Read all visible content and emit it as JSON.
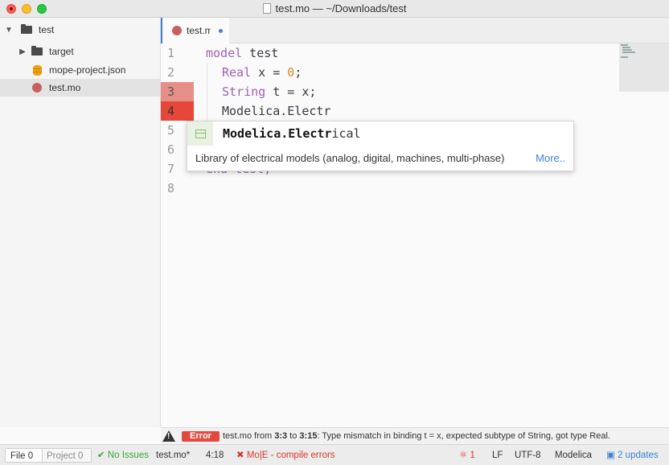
{
  "window": {
    "title": "test.mo — ~/Downloads/test"
  },
  "sidebar": {
    "root": "test",
    "items": [
      {
        "label": "target"
      },
      {
        "label": "mope-project.json"
      },
      {
        "label": "test.mo"
      }
    ]
  },
  "tab": {
    "label": "test.mo"
  },
  "editor": {
    "line_numbers": [
      "1",
      "2",
      "3",
      "4",
      "5",
      "6",
      "7",
      "8"
    ],
    "lines": [
      {
        "kw": "model",
        "rest": " test"
      },
      {
        "kw": "Real",
        "pre": " x = ",
        "num": "0",
        "post": ";"
      },
      {
        "kw": "String",
        "rest": " t = x;"
      },
      {
        "plain": "Modelica.Electr"
      },
      {
        "hidden_fragment": "end test;"
      }
    ]
  },
  "autocomplete": {
    "typed": "Modelica.Electr",
    "rest": "ical",
    "description": "Library of electrical models (analog, digital, machines, multi-phase)",
    "more": "More.."
  },
  "error_panel": {
    "badge": "Error",
    "file": "test.mo",
    "from_word": "from",
    "from": "3:3",
    "to_word": "to",
    "to": "3:15",
    "message": ": Type mismatch in binding t = x, expected subtype of String, got type Real."
  },
  "status": {
    "file_label": "File",
    "file_count": "0",
    "project_label": "Project",
    "project_count": "0",
    "no_issues": "No Issues",
    "filename": "test.mo*",
    "cursor": "4:18",
    "compile_errors": "Mo|E - compile errors",
    "bug_count": "1",
    "line_ending": "LF",
    "encoding": "UTF-8",
    "grammar": "Modelica",
    "updates": "2 updates"
  },
  "colors": {
    "accent": "#3a83d6",
    "error": "#e5473b",
    "keyword": "#a15fb8",
    "number": "#d78a18"
  }
}
